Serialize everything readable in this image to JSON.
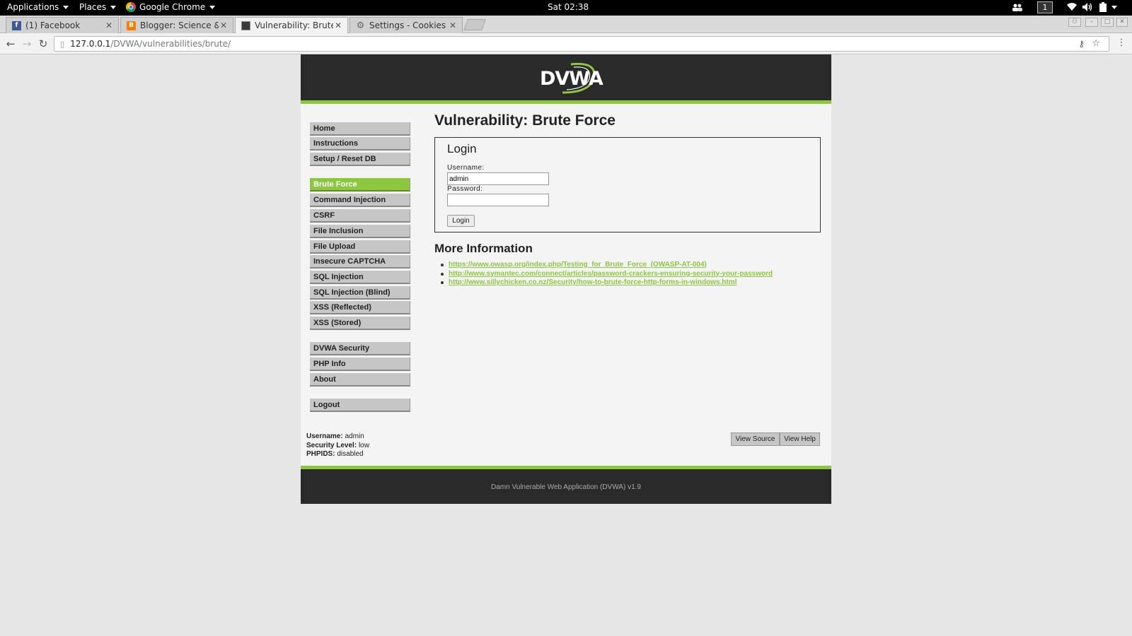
{
  "os_panel": {
    "applications": "Applications",
    "places": "Places",
    "active_app": "Google Chrome",
    "clock": "Sat 02:38",
    "workspace": "1"
  },
  "browser": {
    "tabs": [
      {
        "label": "(1) Facebook",
        "icon": "facebook-icon",
        "active": false
      },
      {
        "label": "Blogger: Science &",
        "icon": "blogger-icon",
        "active": false
      },
      {
        "label": "Vulnerability: Brute",
        "icon": "dvwa-icon",
        "active": true
      },
      {
        "label": "Settings - Cookies a",
        "icon": "gear-icon",
        "active": false
      }
    ],
    "url_host": "127.0.0.1",
    "url_path": "/DVWA/vulnerabilities/brute/"
  },
  "dvwa": {
    "logo": "DVWA",
    "menu": {
      "group1": [
        "Home",
        "Instructions",
        "Setup / Reset DB"
      ],
      "group2": [
        "Brute Force",
        "Command Injection",
        "CSRF",
        "File Inclusion",
        "File Upload",
        "Insecure CAPTCHA",
        "SQL Injection",
        "SQL Injection (Blind)",
        "XSS (Reflected)",
        "XSS (Stored)"
      ],
      "group3": [
        "DVWA Security",
        "PHP Info",
        "About"
      ],
      "group4": [
        "Logout"
      ],
      "selected": "Brute Force"
    },
    "page_title": "Vulnerability: Brute Force",
    "login": {
      "title": "Login",
      "username_label": "Username:",
      "username_value": "admin",
      "password_label": "Password:",
      "password_value": "",
      "button": "Login"
    },
    "more_info": {
      "title": "More Information",
      "links": [
        "https://www.owasp.org/index.php/Testing_for_Brute_Force_(OWASP-AT-004)",
        "http://www.symantec.com/connect/articles/password-crackers-ensuring-security-your-password",
        "http://www.sillychicken.co.nz/Security/how-to-brute-force-http-forms-in-windows.html"
      ]
    },
    "user_info": {
      "username_label": "Username:",
      "username": "admin",
      "security_label": "Security Level:",
      "security": "low",
      "phpids_label": "PHPIDS:",
      "phpids": "disabled"
    },
    "view_source": "View Source",
    "view_help": "View Help",
    "footer": "Damn Vulnerable Web Application (DVWA) v1.9",
    "colors": {
      "accent": "#8dc63f",
      "header": "#2a2a2a"
    }
  }
}
